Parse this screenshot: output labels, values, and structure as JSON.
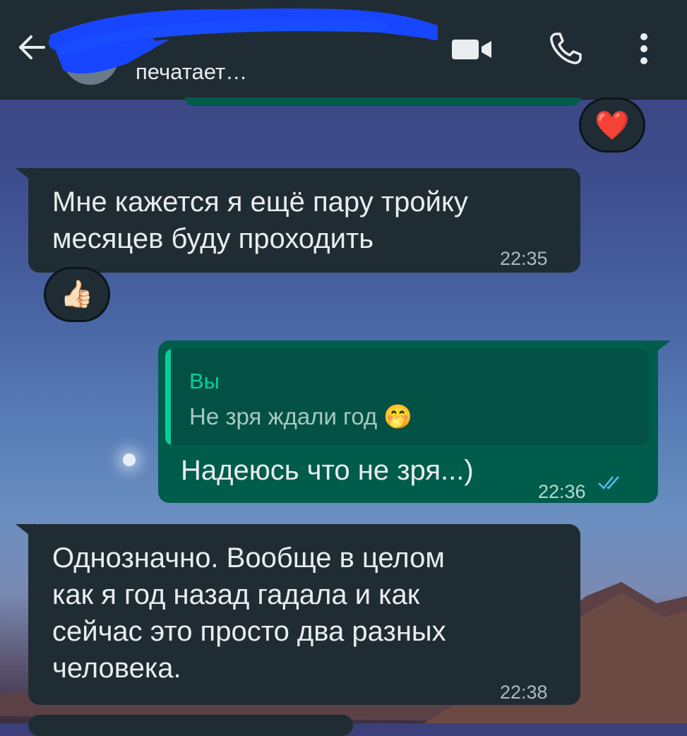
{
  "header": {
    "status": "печатает…",
    "icons": {
      "back": "arrow-left-icon",
      "video": "video-call-icon",
      "phone": "phone-call-icon",
      "menu": "more-vert-icon"
    }
  },
  "messages": [
    {
      "direction": "out",
      "reaction": "❤️",
      "note": "partially visible message"
    },
    {
      "direction": "in",
      "text_lines": [
        "Мне кажется я ещё пару тройку",
        "месяцев буду проходить"
      ],
      "time": "22:35",
      "reaction": "👍🏻"
    },
    {
      "direction": "out",
      "quote": {
        "author": "Вы",
        "text": "Не зря ждали год 🤭"
      },
      "text": "Надеюсь что не зря...)",
      "time": "22:36",
      "read": true
    },
    {
      "direction": "in",
      "text_lines": [
        "Однозначно. Вообще в целом",
        "как я год назад гадала и как",
        "сейчас это просто два разных",
        "человека."
      ],
      "time": "22:38"
    }
  ],
  "colors": {
    "header": "#202c33",
    "incoming": "#202c33",
    "outgoing": "#005c4b",
    "accent": "#06cf9c",
    "scribble": "#1846ff"
  }
}
